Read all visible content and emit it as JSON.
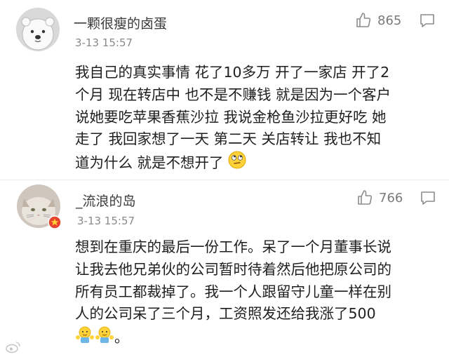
{
  "comments": [
    {
      "username": "一颗很瘦的卤蛋",
      "time": "3-13 15:57",
      "likes": "865",
      "avatar": "polar-bear-avatar",
      "lines": [
        "我自己的真实事情 花了10多万 开了一家店 开了2",
        "个月 现在转店中 也不是不赚钱 就是因为一个客户",
        "说她要吃苹果香蕉沙拉 我说金枪鱼沙拉更好吃 她",
        "走了 我回家想了一天 第二天 关店转让 我也不知",
        "道为什么 就是不想开了"
      ],
      "emoji": "eye-roll-emoji"
    },
    {
      "username": "_流浪的岛",
      "time": "3-13 15:57",
      "likes": "766",
      "avatar": "cat-avatar",
      "lines": [
        "想到在重庆的最后一份工作。呆了一个月董事长说",
        "让我去他兄弟伙的公司暂时待着然后他把原公司的",
        "所有员工都裁掉了。我一个人跟留守儿童一样在别",
        "人的公司呆了三个月，工资照发还给我涨了500",
        "。"
      ],
      "emoji": "shrug-emoji"
    }
  ],
  "colors": {
    "text": "#1f1f1f",
    "meta": "#8a8a8a",
    "icon": "#8c8c8c",
    "badge": "#e8432e"
  }
}
